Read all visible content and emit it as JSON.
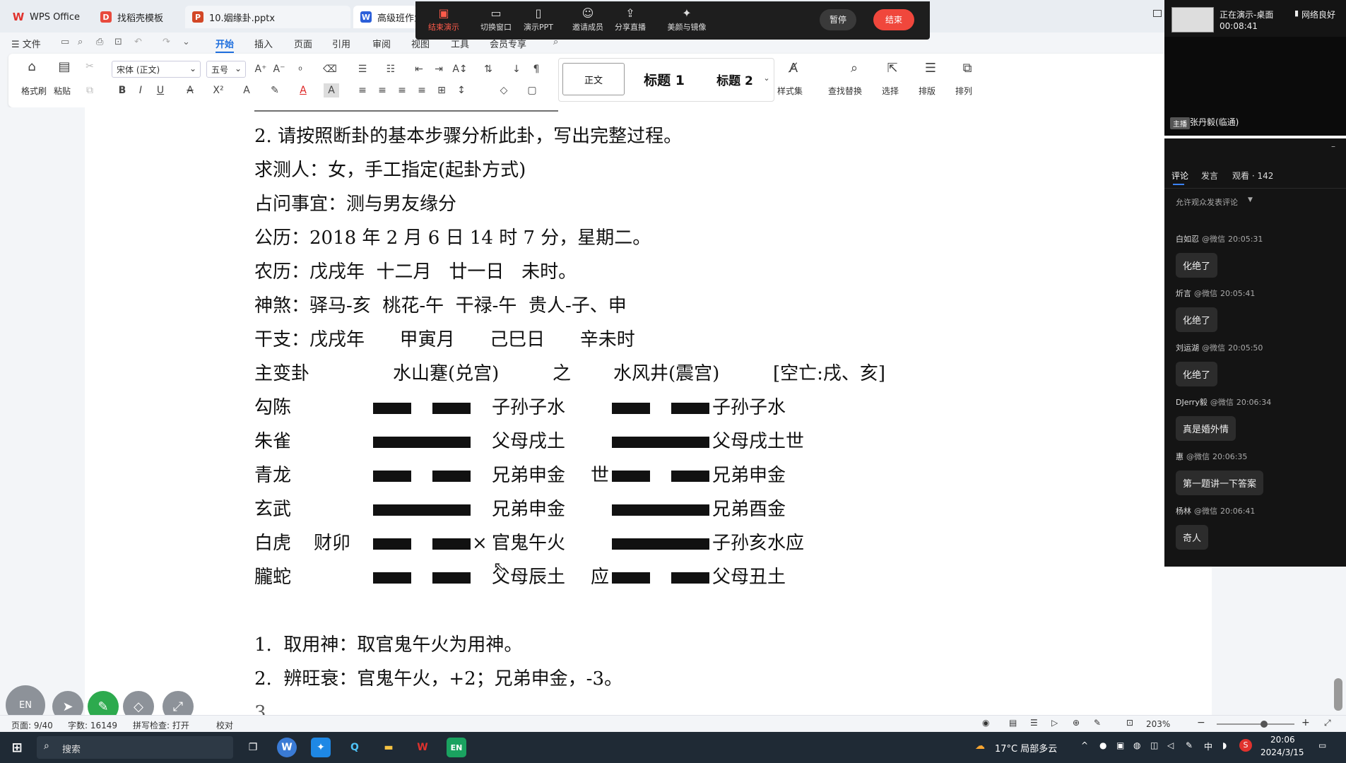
{
  "tabs": [
    {
      "label": "WPS Office",
      "icon": "W"
    },
    {
      "label": "找稻壳模板",
      "icon": "D"
    },
    {
      "label": "10.姻缘卦.pptx",
      "icon": "P"
    },
    {
      "label": "高级班作业",
      "icon": "W"
    }
  ],
  "menu": {
    "file": "☰ 文件",
    "items": [
      "开始",
      "插入",
      "页面",
      "引用",
      "审阅",
      "视图",
      "工具",
      "会员专享"
    ]
  },
  "ribbon": {
    "format_painter": "格式刷",
    "paste": "粘贴",
    "font_name": "宋体 (正文)",
    "font_size": "五号",
    "style_normal": "正文",
    "style_h1": "标题 1",
    "style_h2": "标题 2",
    "style_set": "样式集",
    "find_replace": "查找替换",
    "select": "选择",
    "layout": "排版",
    "arrange": "排列"
  },
  "meeting": {
    "end_demo": "结束演示",
    "switch_window": "切换窗口",
    "demo_ppt": "演示PPT",
    "invite": "邀请成员",
    "share_live": "分享直播",
    "beauty": "美颜与镜像",
    "pause": "暂停",
    "end": "结束"
  },
  "doc": {
    "l0": "2. 请按照断卦的基本步骤分析此卦，写出完整过程。",
    "l1": "求测人：女，手工指定(起卦方式)",
    "l2": "占问事宜：测与男友缘分",
    "l3": "公历：2018 年 2 月 6 日 14 时 7 分，星期二。",
    "l4": "农历：戊戌年  十二月   廿一日   未时。",
    "l5": "神煞：驿马-亥  桃花-午  干禄-午  贵人-子、申",
    "l6": "干支：戊戌年      甲寅月      己巳日      辛未时",
    "l7a": "主变卦",
    "l7b": "水山蹇(兑宫)",
    "l7c": "之",
    "l7d": "水风井(震宫)",
    "l7e": "[空亡:戌、亥]",
    "rows": [
      {
        "god": "勾陈",
        "fu": "",
        "main": "子孙子水",
        "mark": "",
        "change": "",
        "bian": "子孙子水"
      },
      {
        "god": "朱雀",
        "fu": "",
        "main": "父母戌土",
        "mark": "",
        "change": "",
        "bian": "父母戌土世"
      },
      {
        "god": "青龙",
        "fu": "",
        "main": "兄弟申金",
        "mark": "世",
        "change": "",
        "bian": "兄弟申金"
      },
      {
        "god": "玄武",
        "fu": "",
        "main": "兄弟申金",
        "mark": "",
        "change": "",
        "bian": "兄弟酉金"
      },
      {
        "god": "白虎",
        "fu": "财卯",
        "main": "官鬼午火",
        "mark": "",
        "change": "×",
        "bian": "子孙亥水应"
      },
      {
        "god": "朧蛇",
        "fu": "",
        "main": "父母辰土",
        "mark": "应",
        "change": "",
        "bian": "父母丑土"
      }
    ],
    "main_lines": [
      "yin",
      "yang",
      "yin",
      "yang",
      "yin",
      "yin"
    ],
    "bian_lines": [
      "yin",
      "yang",
      "yin",
      "yang",
      "yang",
      "yin"
    ],
    "a1": "1.  取用神：取官鬼午火为用神。",
    "a2": "2.  辨旺衰：官鬼午火，+2；兄弟申金，-3。"
  },
  "status": {
    "page": "页面: 9/40",
    "words": "字数: 16149",
    "spell": "拼写检查: 打开",
    "proof": "校对",
    "zoom": "203%"
  },
  "taskbar": {
    "search": "搜索",
    "weather": "17°C  局部多云",
    "ime": "中",
    "time": "20:06",
    "date": "2024/3/15"
  },
  "panel": {
    "presenting": "正在演示-桌面",
    "timer": "00:08:41",
    "network": "网络良好",
    "host_tag": "主播",
    "host_name": "张丹毅(临通)",
    "tab_comment": "评论",
    "tab_speak": "发言",
    "tab_watch": "观看 · 142",
    "allow": "允许观众发表评论",
    "comments": [
      {
        "name": "白如忍",
        "src": "@微信",
        "time": "20:05:31",
        "text": "化绝了"
      },
      {
        "name": "炘言",
        "src": "@微信",
        "time": "20:05:41",
        "text": "化绝了"
      },
      {
        "name": "刘运湖",
        "src": "@微信",
        "time": "20:05:50",
        "text": "化绝了"
      },
      {
        "name": "DJerry毅",
        "src": "@微信",
        "time": "20:06:34",
        "text": "真是婚外情"
      },
      {
        "name": "惠",
        "src": "@微信",
        "time": "20:06:35",
        "text": "第一题讲一下答案"
      },
      {
        "name": "杨林",
        "src": "@微信",
        "time": "20:06:41",
        "text": "奇人"
      }
    ]
  }
}
